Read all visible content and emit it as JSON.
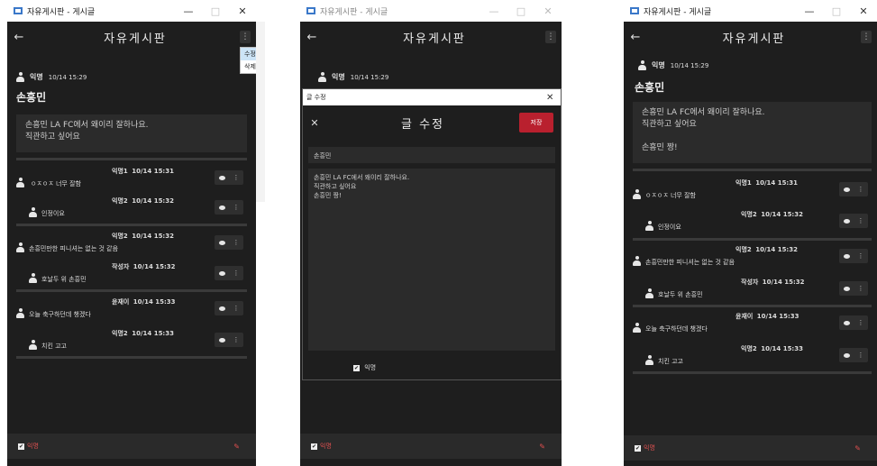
{
  "window": {
    "title": "자유게시판 - 게시글",
    "min": "—",
    "max": "□",
    "close": "✕"
  },
  "header": {
    "back": "←",
    "title": "자유게시판",
    "menu": "⋮"
  },
  "context_menu": {
    "edit": "수정",
    "delete": "삭제"
  },
  "post": {
    "author": "익명",
    "datetime": "10/14 15:29",
    "title": "손흥민",
    "content_lines": [
      "손흥민 LA FC에서 왜이리 잘하나요.",
      "직관하고 싶어요"
    ],
    "edited_content_lines": [
      "손흥민 LA FC에서 왜이리 잘하나요.",
      "직관하고 싶어요",
      "",
      "손흥민 짱!"
    ]
  },
  "comments": [
    {
      "author": "익명1",
      "datetime": "10/14 15:31",
      "text": "ㅇㅈㅇㅈ 너무 잘함",
      "reply": false
    },
    {
      "author": "익명2",
      "datetime": "10/14 15:32",
      "text": "인정이요",
      "reply": true
    },
    {
      "author": "익명2",
      "datetime": "10/14 15:32",
      "text": "손흥민만한 피니셔는 없는 것 같음",
      "reply": false
    },
    {
      "author": "작성자",
      "datetime": "10/14 15:32",
      "text": "호날두 위 손흥민",
      "reply": true
    },
    {
      "author": "윤재이",
      "datetime": "10/14 15:33",
      "text": "오늘 축구하던데 챙겠다",
      "reply": false
    },
    {
      "author": "익명2",
      "datetime": "10/14 15:33",
      "text": "치킨 고고",
      "reply": true
    }
  ],
  "comment_buttons": {
    "reply_icon": "speech-bubble-icon",
    "menu": "⋮"
  },
  "footer": {
    "check": "✔",
    "anon_label": "익명",
    "write_icon": "✎"
  },
  "edit_dialog": {
    "window_title": "글 수정",
    "close": "✕",
    "title": "글 수정",
    "save": "저장",
    "title_value": "손흥민",
    "anon_label": "익명"
  },
  "colors": {
    "accent": "#b9202e",
    "background": "#1e1e1e",
    "panel": "#2b2b2b"
  }
}
